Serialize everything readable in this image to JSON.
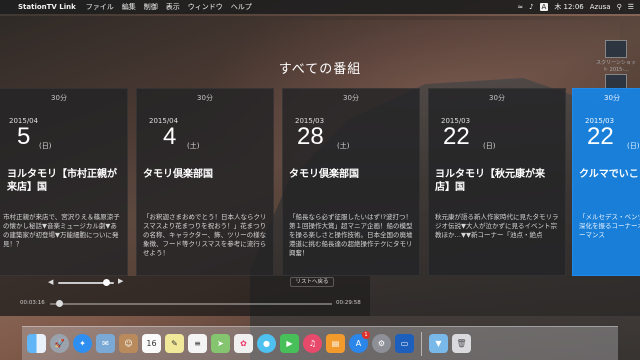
{
  "menubar": {
    "app_name": "StationTV Link",
    "items": [
      "ファイル",
      "編集",
      "制御",
      "表示",
      "ウィンドウ",
      "ヘルプ"
    ],
    "ime": "A",
    "clock": "木 12:06",
    "user": "Azusa"
  },
  "desktop": {
    "icon1_label": "スクリーンショット 2015-..."
  },
  "page": {
    "title": "すべての番組"
  },
  "programs": [
    {
      "duration": "30分",
      "year_month": "2015/04",
      "day": "5",
      "weekday": "(日)",
      "title": "ヨルタモリ【市村正親が来店】国",
      "description": "市村正親が来店で、宮沢りえ＆篠原涼子の懐かし秘話▼音楽ミュージカル劇▼あの建築家が初登場▼万能細胞についに発見！？"
    },
    {
      "duration": "30分",
      "year_month": "2015/04",
      "day": "4",
      "weekday": "(土)",
      "title": "タモリ倶楽部国",
      "description": "「お釈迦さまおめでとう！日本人ならクリスマスより花まつりを祝おう！」花まつりの名称、キャラクター、飾、ツリーの様な象徴、フード等クリスマスを参考に流行らせよう！"
    },
    {
      "duration": "30分",
      "year_month": "2015/03",
      "day": "28",
      "weekday": "(土)",
      "title": "タモリ倶楽部国",
      "description": "「船長なら必ず征服したいはず!?波打つ！第１回操作大賞」超マニア企画！船の模型を操る楽しさと操作技術。日本全国の廃墟港道に挑む船長達の超絶操作テクにタモリ興奮！"
    },
    {
      "duration": "30分",
      "year_month": "2015/03",
      "day": "22",
      "weekday": "(日)",
      "title": "ヨルタモリ【秋元康が来店】国",
      "description": "秋元康が語る新人作家時代に見たタモリラジオ伝説▼大人が泣かずに見るイベント宗教ほか…▼▼新コーナー「池点・絶点"
    },
    {
      "duration": "30分",
      "year_month": "2015/03",
      "day": "22",
      "weekday": "(日)",
      "title": "クルマでいこ",
      "description": "「メルセデス・ベンツ深化を振るコーナーオーマンス"
    }
  ],
  "player": {
    "time_elapsed": "00:03:16",
    "time_total": "00:29:58",
    "button_label": "リストへ戻る",
    "volume_level": 0.85,
    "seek_position": 0.02
  },
  "dock": {
    "icons": [
      "finder-icon",
      "launchpad-icon",
      "safari-icon",
      "mail-icon",
      "contacts-icon",
      "calendar-icon",
      "notes-icon",
      "reminders-icon",
      "maps-icon",
      "photos-icon",
      "messages-icon",
      "facetime-icon",
      "itunes-icon",
      "ibooks-icon",
      "appstore-icon",
      "preferences-icon",
      "stationtv-icon",
      "folder-icon",
      "trash-icon"
    ],
    "calendar_day": "16",
    "appstore_badge": "1"
  }
}
